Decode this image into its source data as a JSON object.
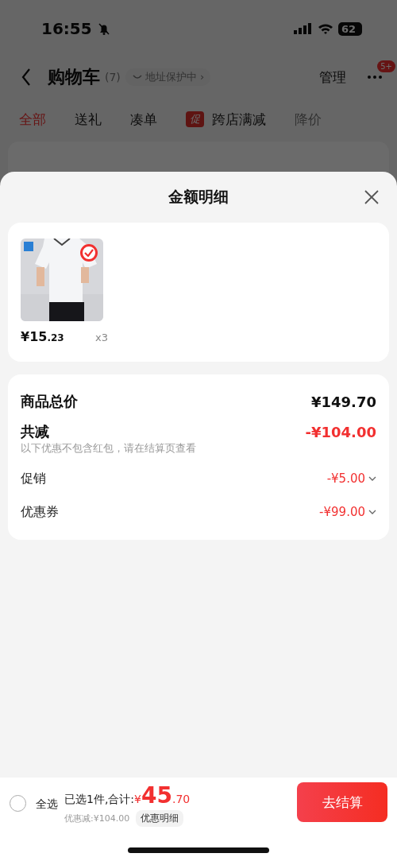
{
  "status_bar": {
    "time": "16:55",
    "silent": true,
    "battery": "62"
  },
  "header": {
    "title": "购物车",
    "count": "(7)",
    "address_chip": "地址保护中 ›",
    "manage": "管理",
    "more_badge": "5+"
  },
  "tabs": [
    {
      "label": "全部",
      "selected": true,
      "faded": false
    },
    {
      "label": "送礼",
      "selected": false,
      "faded": false
    },
    {
      "label": "凑单",
      "selected": false,
      "faded": false
    },
    {
      "label": "跨店满减",
      "selected": false,
      "faded": false,
      "tag": "促"
    },
    {
      "label": "降价",
      "selected": false,
      "faded": true
    }
  ],
  "sheet": {
    "title": "金额明细",
    "items": [
      {
        "kind": "picture",
        "selected": true,
        "price_integer": "¥15",
        "price_decimal": ".23",
        "quantity": "x3"
      }
    ],
    "lines": [
      {
        "kind": "total",
        "label": "商品总价",
        "amount": "¥149.70"
      },
      {
        "kind": "reduction",
        "label": "共减",
        "amount": "-¥104.00"
      },
      {
        "kind": "note",
        "label": "以下优惠不包含红包，请在结算页查看"
      },
      {
        "kind": "discount",
        "label": "促销",
        "amount": "-¥5.00",
        "expanded": false
      },
      {
        "kind": "discount",
        "label": "优惠券",
        "amount": "-¥99.00",
        "expanded": false
      }
    ]
  },
  "footer": {
    "select_all": {
      "label": "全选",
      "checked": false
    },
    "summary": "已选1件,合计:",
    "total_currency": "¥",
    "total_integer": "45",
    "total_decimal": ".70",
    "saved": "优惠减:¥104.00",
    "details_button": "优惠明细",
    "checkout_button": "去结算"
  }
}
